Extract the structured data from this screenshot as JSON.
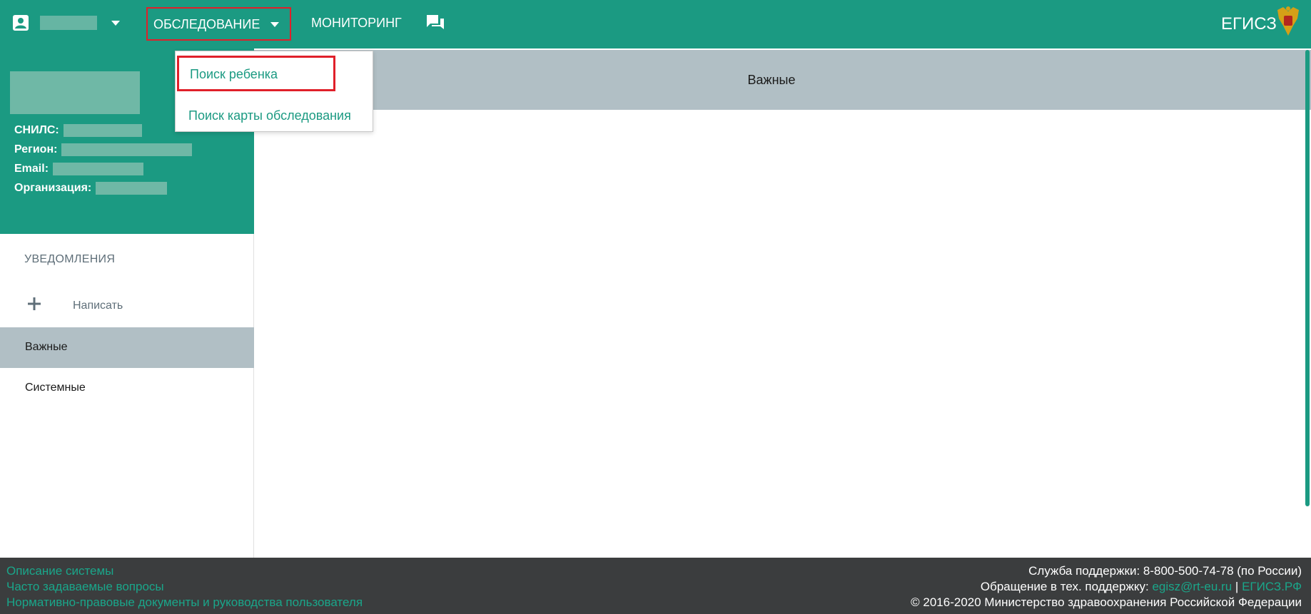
{
  "header": {
    "menu_survey": "ОБСЛЕДОВАНИЕ",
    "menu_monitoring": "МОНИТОРИНГ",
    "brand": "ЕГИСЗ",
    "icons": [
      "user-icon",
      "chevron-down-icon",
      "chat-icon",
      "emblem-icon"
    ]
  },
  "dropdown": {
    "items": [
      {
        "label": "Поиск ребенка"
      },
      {
        "label": "Поиск карты обследования"
      }
    ]
  },
  "profile": {
    "snils_label": "СНИЛС:",
    "region_label": "Регион:",
    "email_label": "Email:",
    "org_label": "Организация:"
  },
  "sidebar": {
    "heading": "УВЕДОМЛЕНИЯ",
    "write_label": "Написать",
    "items": [
      {
        "label": "Важные"
      },
      {
        "label": "Системные"
      }
    ]
  },
  "content": {
    "title": "Важные"
  },
  "footer": {
    "links": [
      {
        "label": "Описание системы"
      },
      {
        "label": "Часто задаваемые вопросы"
      },
      {
        "label": "Нормативно-правовые документы и руководства пользователя"
      }
    ],
    "support_line": "Служба поддержки: 8-800-500-74-78 (по России)",
    "tech_prefix": "Обращение в тех. поддержку:",
    "tech_email": "egisz@rt-eu.ru",
    "separator": "|",
    "site_link": "ЕГИСЗ.РФ",
    "copyright": "© 2016-2020 Министерство здравоохранения Российской Федерации"
  },
  "colors": {
    "primary": "#1b9a82",
    "header_gray": "#b1bfc5",
    "highlight_red": "#e0202a",
    "footer_bg": "#3b3d3e"
  }
}
